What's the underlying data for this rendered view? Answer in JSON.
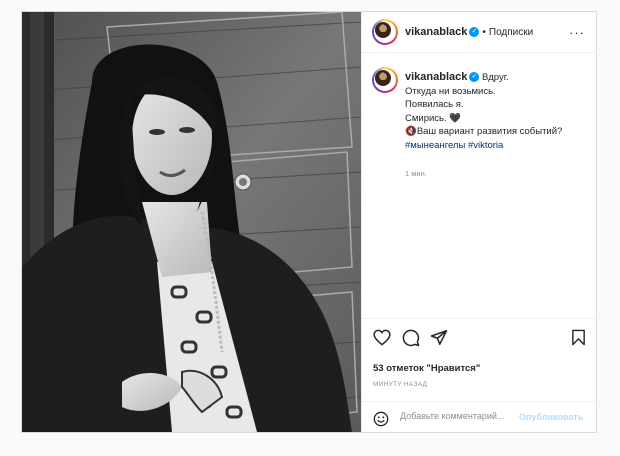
{
  "post": {
    "username": "vikanablack",
    "separator": "•",
    "follow_label": "Подписки",
    "more_label": "···",
    "caption": {
      "username": "vikanablack",
      "lines": [
        "Вдруг.",
        "Откуда ни возьмись.",
        "Появилась я.",
        "Смирись. 🖤",
        "🔇Ваш вариант развития событий?"
      ],
      "hashtags": "#мынеангелы #viktoria"
    },
    "time": "1 мин.",
    "likes": "53 отметок \"Нравится\"",
    "time_ago": "МИНУТУ НАЗАД",
    "comment_placeholder": "Добавьте комментарий...",
    "publish_label": "Опубликовать"
  },
  "colors": {
    "verified": "#0095f6",
    "publish_disabled": "#b2dffc",
    "hashtag": "#00376b"
  },
  "icons": [
    "heart-icon",
    "comment-icon",
    "share-icon",
    "bookmark-icon",
    "emoji-icon",
    "verified-icon",
    "more-icon"
  ]
}
